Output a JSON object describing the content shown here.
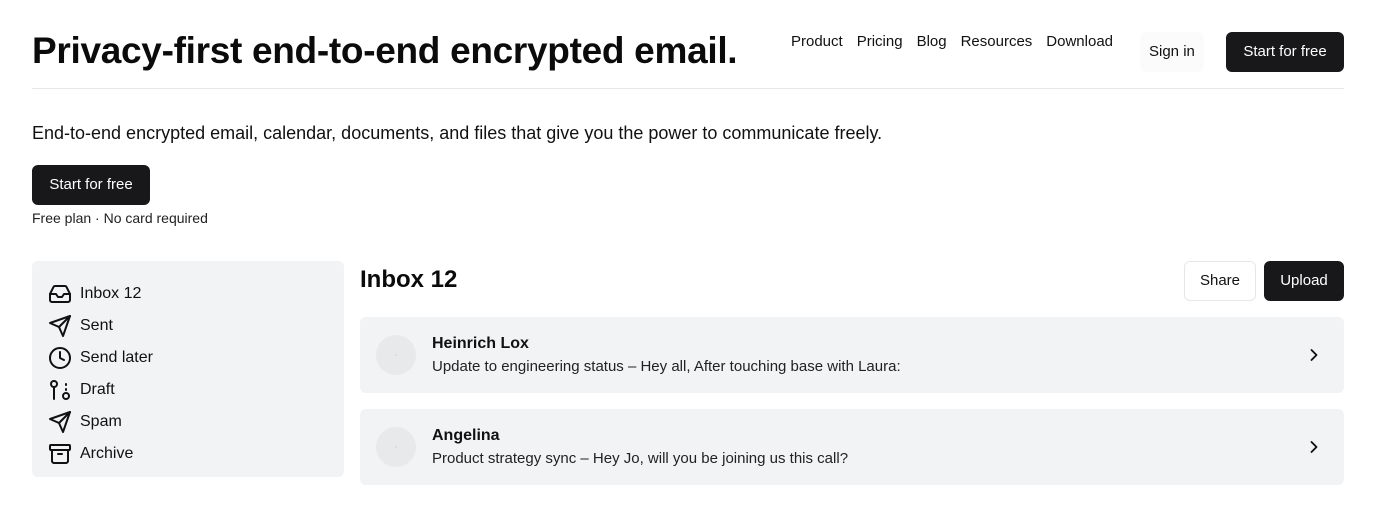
{
  "header": {
    "title": "Privacy-first end-to-end encrypted email.",
    "nav": [
      "Product",
      "Pricing",
      "Blog",
      "Resources",
      "Download"
    ],
    "sign_in": "Sign in",
    "cta": "Start for free"
  },
  "hero": {
    "lead": "End-to-end encrypted email, calendar, documents, and files that give you the power to communicate freely.",
    "cta": "Start for free",
    "note": "Free plan · No card required"
  },
  "sidebar": {
    "items": [
      {
        "label": "Inbox 12",
        "icon": "inbox-icon"
      },
      {
        "label": "Sent",
        "icon": "send-icon"
      },
      {
        "label": "Send later",
        "icon": "clock-icon"
      },
      {
        "label": "Draft",
        "icon": "git-pull-request-icon"
      },
      {
        "label": "Spam",
        "icon": "send-icon"
      },
      {
        "label": "Archive",
        "icon": "archive-icon"
      }
    ]
  },
  "main": {
    "title": "Inbox 12",
    "share": "Share",
    "upload": "Upload",
    "messages": [
      {
        "sender": "Heinrich Lox",
        "preview": "Update to engineering status – Hey all, After touching base with Laura:"
      },
      {
        "sender": "Angelina",
        "preview": "Product strategy sync – Hey Jo, will you be joining us this call?"
      }
    ]
  },
  "colors": {
    "primary_button": "#18181b",
    "panel_bg": "#f1f3f5",
    "divider": "#e5e7eb"
  }
}
